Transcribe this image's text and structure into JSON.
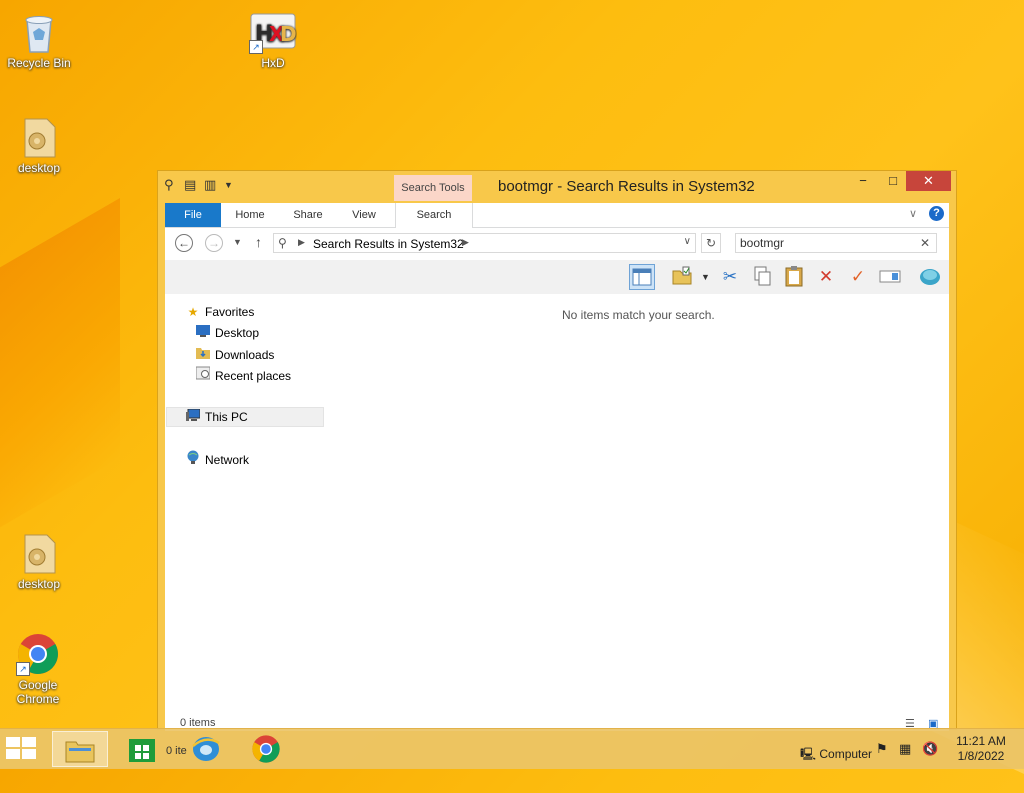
{
  "desktop": {
    "icons": [
      {
        "label": "Recycle Bin",
        "icon": "recycle-bin-icon"
      },
      {
        "label": "HxD",
        "icon": "hxd-icon"
      },
      {
        "label": "desktop",
        "icon": "settings-file-icon"
      },
      {
        "label": "desktop",
        "icon": "settings-file-icon"
      },
      {
        "label": "Google Chrome",
        "icon": "chrome-icon"
      }
    ]
  },
  "window": {
    "title": "bootmgr - Search Results in System32",
    "context_tab_group": "Search Tools",
    "ribbon_tabs": [
      "File",
      "Home",
      "Share",
      "View",
      "Search"
    ],
    "address_path": "Search Results in System32",
    "search_value": "bootmgr",
    "no_items_message": "No items match your search.",
    "status_count": "0 items",
    "nav": {
      "favorites": "Favorites",
      "desktop": "Desktop",
      "downloads": "Downloads",
      "recent": "Recent places",
      "this_pc": "This PC",
      "network": "Network"
    },
    "controls": {
      "minimize": "−",
      "maximize": "□",
      "close": "✕"
    }
  },
  "taskbar": {
    "status_text": "0 ite",
    "tray_computer": "Computer",
    "time": "11:21 AM",
    "date": "1/8/2022"
  },
  "colors": {
    "desktop_bg": "#fdbd0f",
    "window_frame": "#f8c84a",
    "file_tab": "#1979ca",
    "close_button": "#c7453b",
    "context_tab": "#fbd6c8"
  }
}
